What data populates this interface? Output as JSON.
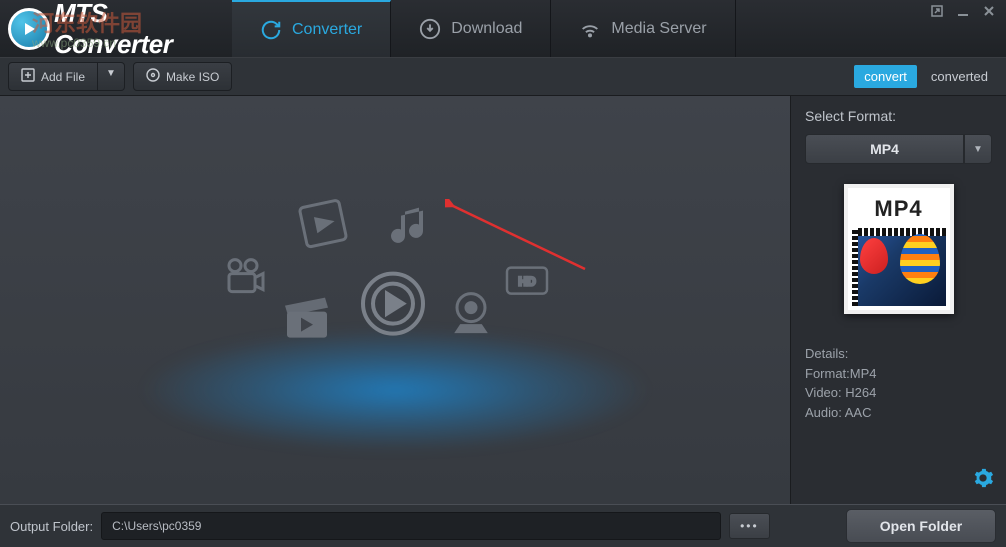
{
  "app": {
    "title": "MTS Converter",
    "watermark_line1": "河东软件园",
    "watermark_line2": "www.pc0359.cn"
  },
  "tabs": {
    "converter": "Converter",
    "download": "Download",
    "media_server": "Media Server"
  },
  "toolbar": {
    "add_file": "Add File",
    "make_iso": "Make ISO",
    "convert": "convert",
    "converted": "converted"
  },
  "side": {
    "select_format": "Select Format:",
    "format_value": "MP4",
    "thumb_label": "MP4",
    "details_heading": "Details:",
    "format_line": "Format:MP4",
    "video_line": "Video: H264",
    "audio_line": "Audio: AAC"
  },
  "footer": {
    "label": "Output Folder:",
    "path": "C:\\Users\\pc0359",
    "browse": "•••",
    "open_folder": "Open Folder"
  },
  "icons": {
    "refresh": "refresh-icon",
    "download": "download-icon",
    "wifi": "wifi-icon",
    "add": "add-icon",
    "disc": "disc-icon",
    "gear": "gear-icon",
    "popout": "popout-icon",
    "minimize": "minimize-icon",
    "close": "close-icon"
  }
}
